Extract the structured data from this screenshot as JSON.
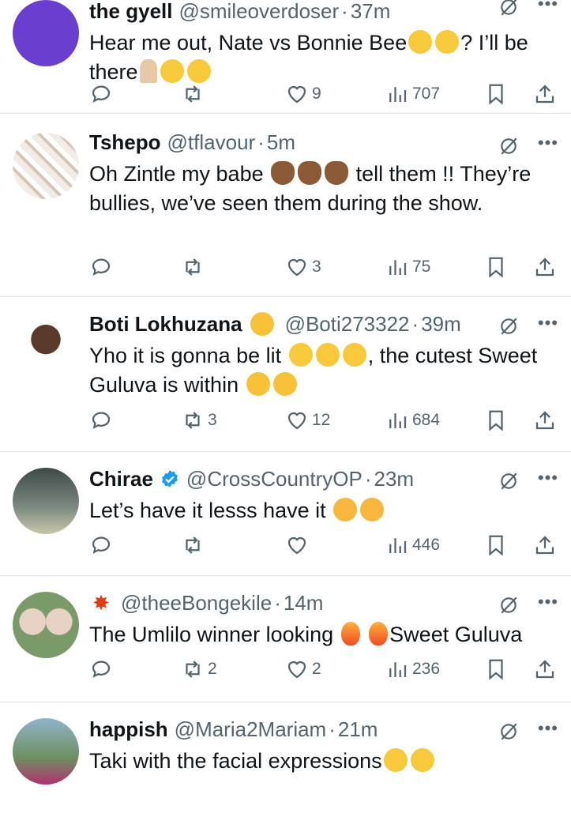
{
  "tweets": [
    {
      "name": "the gyell",
      "handle": "@smileoverdoser",
      "time": "37m",
      "text_parts": [
        "Hear me out, Nate vs Bonnie Bee",
        "? I’ll be there"
      ],
      "replies": "",
      "retweets": "",
      "likes": "9",
      "views": "707",
      "avatar_color": "#6a3fd0"
    },
    {
      "name": "Tshepo",
      "handle": "@tflavour",
      "time": "5m",
      "text_parts": [
        "Oh Zintle  my babe",
        "tell them !! They’re bullies, we’ve seen them during the show."
      ],
      "replies": "",
      "retweets": "",
      "likes": "3",
      "views": "75"
    },
    {
      "name": "Boti Lokhuzana",
      "handle": "@Boti273322",
      "time": "39m",
      "text_parts": [
        "Yho it is gonna be lit",
        ", the cutest Sweet Guluva is within"
      ],
      "replies": "",
      "retweets": "3",
      "likes": "12",
      "views": "684"
    },
    {
      "name": "Chirae",
      "handle": "@CrossCountryOP",
      "time": "23m",
      "text_parts": [
        "Let’s have it lesss have it"
      ],
      "replies": "",
      "retweets": "",
      "likes": "",
      "views": "446",
      "verified_color": "#1d9bf0"
    },
    {
      "name": "",
      "handle": "@theeBongekile",
      "time": "14m",
      "text_parts": [
        "The Umlilo winner looking",
        "Sweet Guluva"
      ],
      "replies": "",
      "retweets": "2",
      "likes": "2",
      "views": "236"
    },
    {
      "name": "happish",
      "handle": "@Maria2Mariam",
      "time": "21m",
      "text_parts": [
        "Taki with the facial expressions"
      ],
      "replies": "",
      "retweets": "",
      "likes": "",
      "views": ""
    }
  ],
  "dot": "·",
  "more_glyph": "•••",
  "icons": {
    "reply": "reply-icon",
    "retweet": "retweet-icon",
    "like": "heart-icon",
    "views": "views-icon",
    "bookmark": "bookmark-icon",
    "share": "share-icon",
    "grok": "grok-icon"
  },
  "colors": {
    "secondary": "#536471",
    "text": "#0f1419",
    "divider": "#e3e6e8",
    "verified": "#1d9bf0"
  }
}
